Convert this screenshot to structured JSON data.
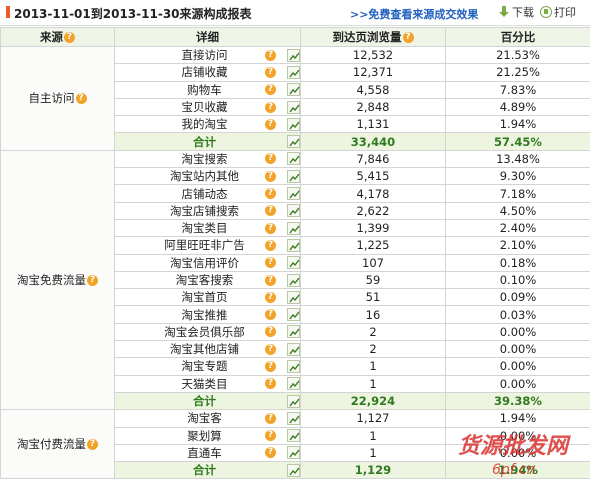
{
  "header": {
    "title": "2013-11-01到2013-11-30来源构成报表",
    "link": ">>免费查看来源成交效果",
    "download": "下载",
    "print": "打印"
  },
  "columns": {
    "source": "来源",
    "detail": "详细",
    "pv": "到达页浏览量",
    "pct": "百分比"
  },
  "groups": [
    {
      "name": "自主访问",
      "rows": [
        {
          "label": "直接访问",
          "pv": "12,532",
          "pct": "21.53%"
        },
        {
          "label": "店铺收藏",
          "pv": "12,371",
          "pct": "21.25%"
        },
        {
          "label": "购物车",
          "pv": "4,558",
          "pct": "7.83%"
        },
        {
          "label": "宝贝收藏",
          "pv": "2,848",
          "pct": "4.89%"
        },
        {
          "label": "我的淘宝",
          "pv": "1,131",
          "pct": "1.94%"
        }
      ],
      "total": {
        "label": "合计",
        "pv": "33,440",
        "pct": "57.45%"
      }
    },
    {
      "name": "淘宝免费流量",
      "rows": [
        {
          "label": "淘宝搜索",
          "pv": "7,846",
          "pct": "13.48%"
        },
        {
          "label": "淘宝站内其他",
          "pv": "5,415",
          "pct": "9.30%"
        },
        {
          "label": "店铺动态",
          "pv": "4,178",
          "pct": "7.18%"
        },
        {
          "label": "淘宝店铺搜索",
          "pv": "2,622",
          "pct": "4.50%"
        },
        {
          "label": "淘宝类目",
          "pv": "1,399",
          "pct": "2.40%"
        },
        {
          "label": "阿里旺旺非广告",
          "pv": "1,225",
          "pct": "2.10%"
        },
        {
          "label": "淘宝信用评价",
          "pv": "107",
          "pct": "0.18%"
        },
        {
          "label": "淘宝客搜索",
          "pv": "59",
          "pct": "0.10%"
        },
        {
          "label": "淘宝首页",
          "pv": "51",
          "pct": "0.09%"
        },
        {
          "label": "淘宝推推",
          "pv": "16",
          "pct": "0.03%"
        },
        {
          "label": "淘宝会员俱乐部",
          "pv": "2",
          "pct": "0.00%"
        },
        {
          "label": "淘宝其他店铺",
          "pv": "2",
          "pct": "0.00%"
        },
        {
          "label": "淘宝专题",
          "pv": "1",
          "pct": "0.00%"
        },
        {
          "label": "天猫类目",
          "pv": "1",
          "pct": "0.00%"
        }
      ],
      "total": {
        "label": "合计",
        "pv": "22,924",
        "pct": "39.38%"
      }
    },
    {
      "name": "淘宝付费流量",
      "rows": [
        {
          "label": "淘宝客",
          "pv": "1,127",
          "pct": "1.94%"
        },
        {
          "label": "聚划算",
          "pv": "1",
          "pct": "0.00%"
        },
        {
          "label": "直通车",
          "pv": "1",
          "pct": "0.00%"
        }
      ],
      "total": {
        "label": "合计",
        "pv": "1,129",
        "pct": "1.94%"
      }
    }
  ],
  "watermark": {
    "line1": "货源批发网",
    "line2": "6pf.cn"
  },
  "colors": {
    "accent": "#e45d2b",
    "link": "#1f5fbf",
    "total": "#2f7a1f",
    "help": "#f1a32a"
  }
}
